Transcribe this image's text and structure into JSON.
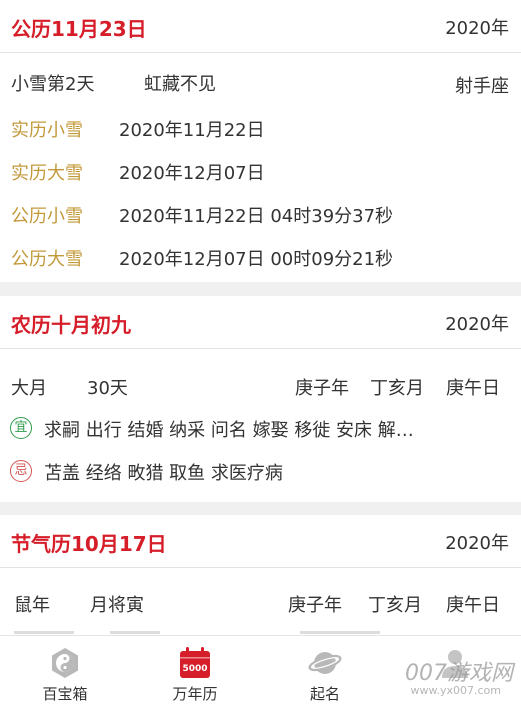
{
  "card1": {
    "title": "公历11月23日",
    "year": "2020年",
    "solar_term": "小雪第2天",
    "phenology": "虹藏不见",
    "zodiac": "射手座",
    "rows": [
      {
        "label": "实历小雪",
        "value": "2020年11月22日"
      },
      {
        "label": "实历大雪",
        "value": "2020年12月07日"
      },
      {
        "label": "公历小雪",
        "value": "2020年11月22日 04时39分37秒"
      },
      {
        "label": "公历大雪",
        "value": "2020年12月07日 00时09分21秒"
      }
    ]
  },
  "card2": {
    "title": "农历十月初九",
    "year": "2020年",
    "month_size": "大月",
    "days": "30天",
    "ganzhi_year": "庚子年",
    "ganzhi_month": "丁亥月",
    "ganzhi_day": "庚午日",
    "yi_label": "宜",
    "yi_text": "求嗣 出行 结婚 纳采 问名 嫁娶 移徙 安床 解…",
    "ji_label": "忌",
    "ji_text": "苫盖 经络 畋猎 取鱼 求医疗病"
  },
  "card3": {
    "title": "节气历10月17日",
    "year": "2020年",
    "animal_year": "鼠年",
    "month_general": "月将寅",
    "ganzhi_year": "庚子年",
    "ganzhi_month": "丁亥月",
    "ganzhi_day": "庚午日"
  },
  "tabbar": {
    "tabs": [
      {
        "label": "百宝箱",
        "icon": "taiji-icon"
      },
      {
        "label": "万年历",
        "icon": "calendar-icon",
        "badge": "5000"
      },
      {
        "label": "起名",
        "icon": "planet-icon"
      },
      {
        "label": "",
        "icon": "person-icon"
      }
    ]
  },
  "watermark": {
    "main": "007游戏网",
    "sub": "www.yx007.com"
  },
  "colors": {
    "title_red": "#d61e2a",
    "label_gold": "#c39a3b",
    "yi_green": "#2e9b4a",
    "ji_red": "#d35454"
  }
}
